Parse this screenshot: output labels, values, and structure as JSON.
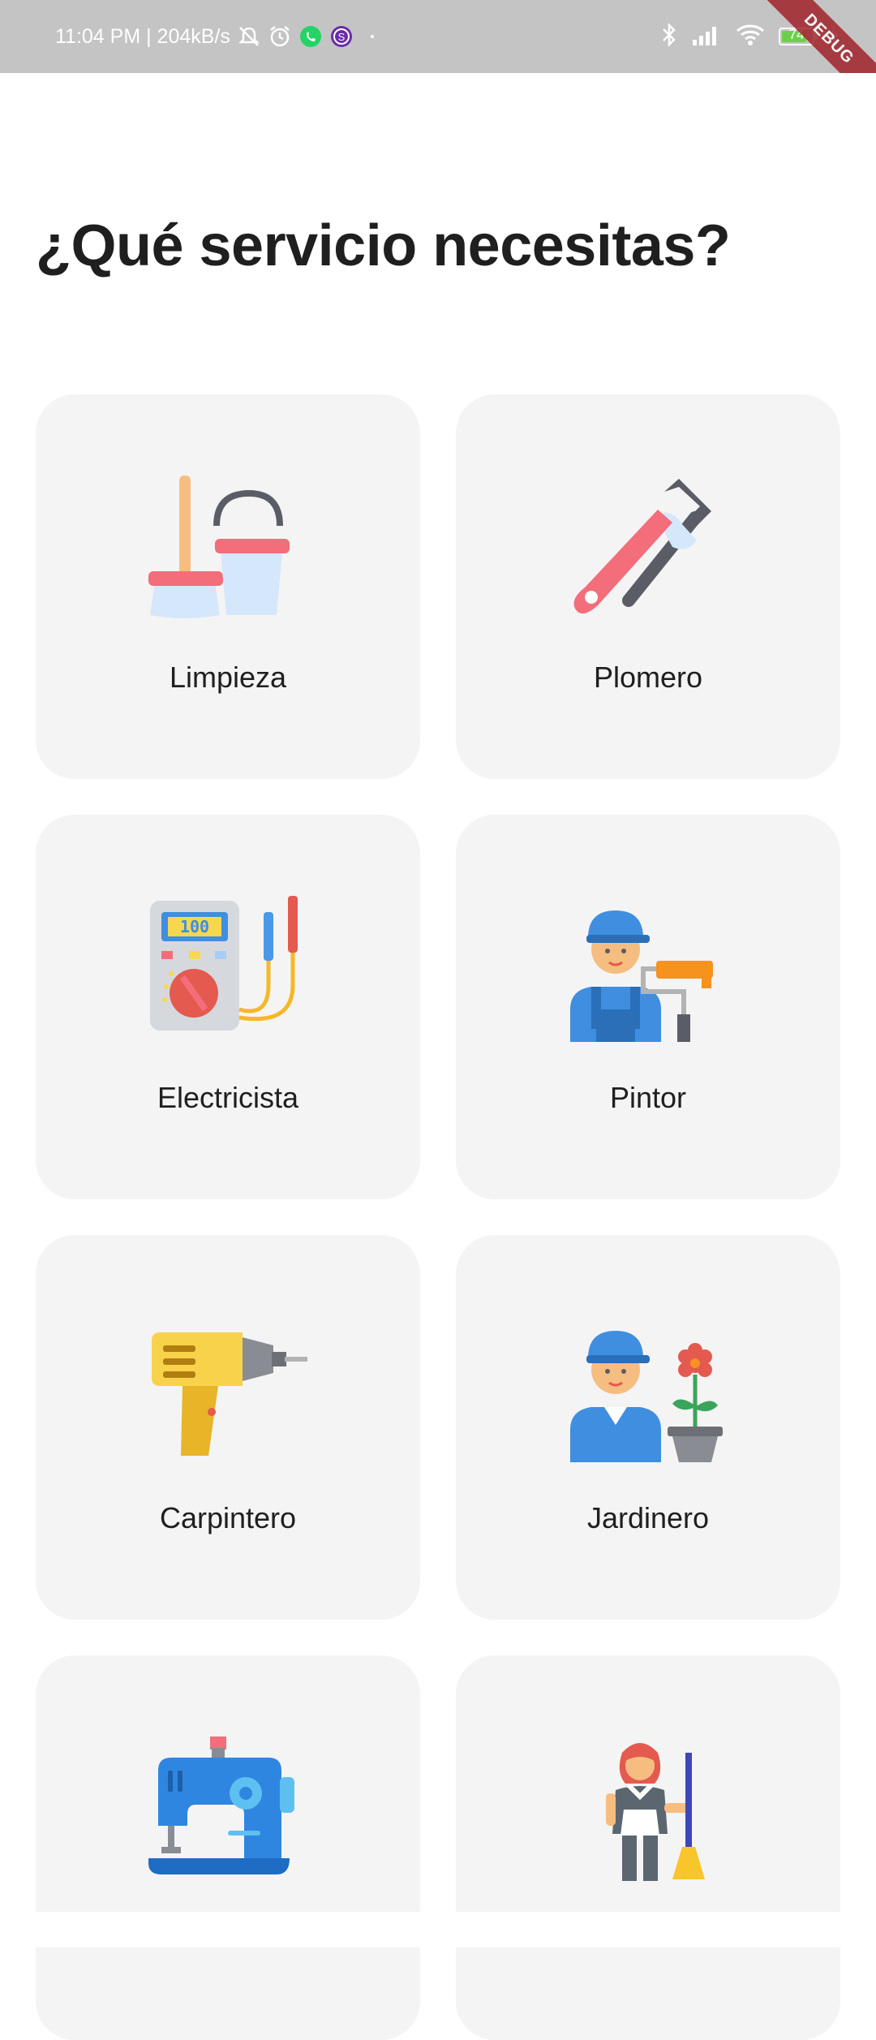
{
  "status_bar": {
    "time_speed": "11:04 PM | 204kB/s",
    "battery_level": "74",
    "debug_label": "DEBUG"
  },
  "page": {
    "title": "¿Qué servicio necesitas?"
  },
  "services": [
    {
      "label": "Limpieza",
      "icon": "mop-bucket-icon"
    },
    {
      "label": "Plomero",
      "icon": "pipe-wrench-icon"
    },
    {
      "label": "Electricista",
      "icon": "multimeter-icon"
    },
    {
      "label": "Pintor",
      "icon": "painter-icon"
    },
    {
      "label": "Carpintero",
      "icon": "drill-icon"
    },
    {
      "label": "Jardinero",
      "icon": "gardener-icon"
    },
    {
      "label": "",
      "icon": "sewing-machine-icon"
    },
    {
      "label": "",
      "icon": "housekeeper-icon"
    }
  ],
  "colors": {
    "card_bg": "#f4f4f4",
    "status_bar_bg": "#c4c4c4",
    "debug_banner": "#a0232b",
    "title_text": "#1f1f1f"
  }
}
